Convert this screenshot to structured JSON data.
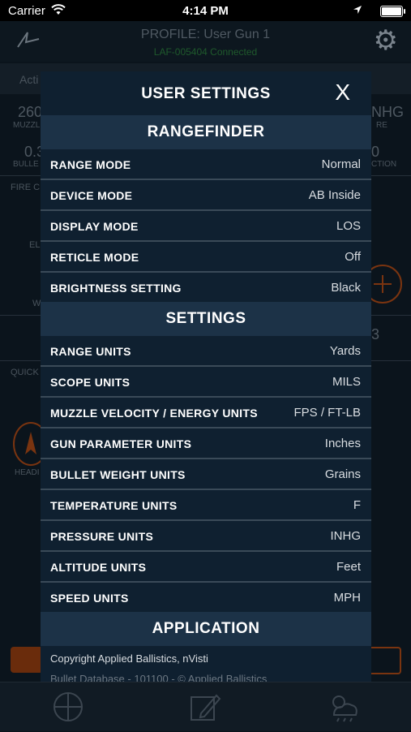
{
  "status_bar": {
    "carrier": "Carrier",
    "time": "4:14 PM"
  },
  "background": {
    "profile_title": "PROFILE: User Gun 1",
    "connection": "LAF-005404 Connected",
    "tab_label": "Acti",
    "muzzle_value": "260",
    "muzzle_label": "MUZZLE",
    "pressure_value": "NHG",
    "pressure_label": "RE",
    "bullet_value": "0.3",
    "bullet_label": "BULLE",
    "correction_value": "0",
    "correction_label": "CTION",
    "fire_label": "FIRE C",
    "elev_label": "EL",
    "w_label": "W",
    "quick_label": "QUICK",
    "heading_label": "HEADI",
    "right_value": "3"
  },
  "modal": {
    "title": "USER SETTINGS",
    "close_label": "X",
    "sections": [
      {
        "title": "RANGEFINDER",
        "rows": [
          {
            "label": "RANGE MODE",
            "value": "Normal"
          },
          {
            "label": "DEVICE MODE",
            "value": "AB Inside"
          },
          {
            "label": "DISPLAY MODE",
            "value": "LOS"
          },
          {
            "label": "RETICLE MODE",
            "value": "Off"
          },
          {
            "label": "BRIGHTNESS SETTING",
            "value": "Black"
          }
        ]
      },
      {
        "title": "SETTINGS",
        "rows": [
          {
            "label": "RANGE UNITS",
            "value": "Yards"
          },
          {
            "label": "SCOPE UNITS",
            "value": "MILS"
          },
          {
            "label": "MUZZLE VELOCITY / ENERGY UNITS",
            "value": "FPS / FT-LB"
          },
          {
            "label": "GUN PARAMETER UNITS",
            "value": "Inches"
          },
          {
            "label": "BULLET WEIGHT UNITS",
            "value": "Grains"
          },
          {
            "label": "TEMPERATURE UNITS",
            "value": "F"
          },
          {
            "label": "PRESSURE UNITS",
            "value": "INHG"
          },
          {
            "label": "ALTITUDE UNITS",
            "value": "Feet"
          },
          {
            "label": "SPEED UNITS",
            "value": "MPH"
          }
        ]
      },
      {
        "title": "APPLICATION"
      }
    ],
    "copyright": "Copyright Applied Ballistics, nVisti",
    "bullet_database": "Bullet Database - 101100 - © Applied Ballistics"
  },
  "tabbar": {
    "icons": [
      "crosshair-icon",
      "edit-icon",
      "weather-icon"
    ]
  }
}
